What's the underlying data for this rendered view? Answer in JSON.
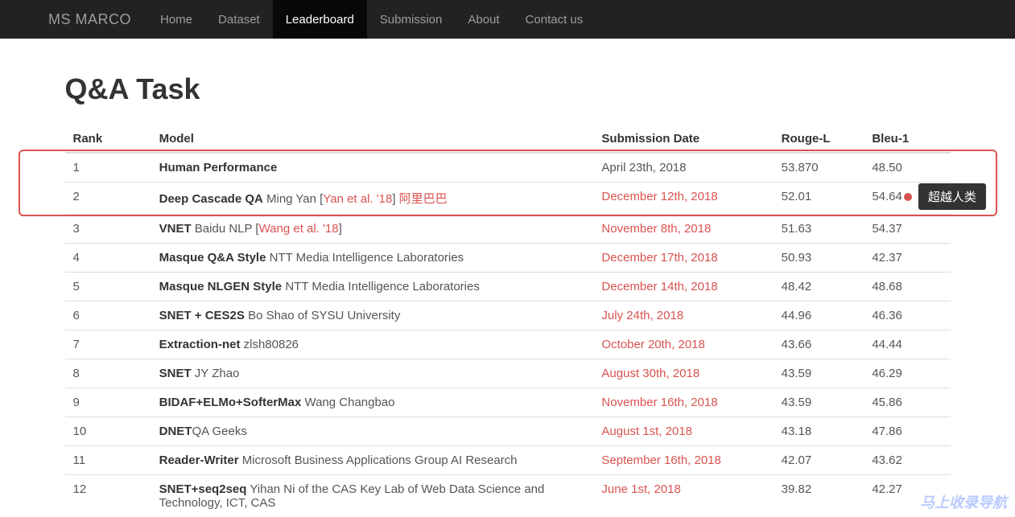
{
  "brand": "MS MARCO",
  "nav": {
    "items": [
      {
        "label": "Home",
        "active": false
      },
      {
        "label": "Dataset",
        "active": false
      },
      {
        "label": "Leaderboard",
        "active": true
      },
      {
        "label": "Submission",
        "active": false
      },
      {
        "label": "About",
        "active": false
      },
      {
        "label": "Contact us",
        "active": false
      }
    ]
  },
  "title": "Q&A Task",
  "columns": {
    "rank": "Rank",
    "model": "Model",
    "date": "Submission Date",
    "rouge": "Rouge-L",
    "bleu": "Bleu-1"
  },
  "rows": [
    {
      "rank": "1",
      "model": "Human Performance",
      "aff": "",
      "ref": null,
      "aff2": null,
      "date": "April 23th, 2018",
      "date_link": false,
      "rouge": "53.870",
      "bleu": "48.50"
    },
    {
      "rank": "2",
      "model": "Deep Cascade QA",
      "aff": " Ming Yan [",
      "ref": "Yan et al. '18",
      "ref_close": "]   ",
      "aff2": "阿里巴巴",
      "date": "December 12th, 2018",
      "date_link": true,
      "rouge": "52.01",
      "bleu": "54.64",
      "dot": true
    },
    {
      "rank": "3",
      "model": "VNET",
      "aff": " Baidu NLP [",
      "ref": "Wang et al. '18",
      "ref_close": "]",
      "aff2": null,
      "date": "November 8th, 2018",
      "date_link": true,
      "rouge": "51.63",
      "bleu": "54.37"
    },
    {
      "rank": "4",
      "model": "Masque Q&A Style",
      "aff": " NTT Media Intelligence Laboratories",
      "ref": null,
      "aff2": null,
      "date": "December 17th, 2018",
      "date_link": true,
      "rouge": "50.93",
      "bleu": "42.37"
    },
    {
      "rank": "5",
      "model": "Masque NLGEN Style",
      "aff": " NTT Media Intelligence Laboratories",
      "ref": null,
      "aff2": null,
      "date": "December 14th, 2018",
      "date_link": true,
      "rouge": "48.42",
      "bleu": "48.68"
    },
    {
      "rank": "6",
      "model": "SNET + CES2S",
      "aff": " Bo Shao of SYSU University",
      "ref": null,
      "aff2": null,
      "date": "July 24th, 2018",
      "date_link": true,
      "rouge": "44.96",
      "bleu": "46.36"
    },
    {
      "rank": "7",
      "model": "Extraction-net",
      "aff": " zlsh80826",
      "ref": null,
      "aff2": null,
      "date": "October 20th, 2018",
      "date_link": true,
      "rouge": "43.66",
      "bleu": "44.44"
    },
    {
      "rank": "8",
      "model": "SNET",
      "aff": " JY Zhao",
      "ref": null,
      "aff2": null,
      "date": "August 30th, 2018",
      "date_link": true,
      "rouge": "43.59",
      "bleu": "46.29"
    },
    {
      "rank": "9",
      "model": "BIDAF+ELMo+SofterMax",
      "aff": " Wang Changbao",
      "ref": null,
      "aff2": null,
      "date": "November 16th, 2018",
      "date_link": true,
      "rouge": "43.59",
      "bleu": "45.86"
    },
    {
      "rank": "10",
      "model": "DNET",
      "aff": "QA Geeks",
      "ref": null,
      "aff2": null,
      "date": "August 1st, 2018",
      "date_link": true,
      "rouge": "43.18",
      "bleu": "47.86"
    },
    {
      "rank": "11",
      "model": "Reader-Writer",
      "aff": " Microsoft Business Applications Group AI Research",
      "ref": null,
      "aff2": null,
      "date": "September 16th, 2018",
      "date_link": true,
      "rouge": "42.07",
      "bleu": "43.62"
    },
    {
      "rank": "12",
      "model": "SNET+seq2seq",
      "aff": " Yihan Ni of the CAS Key Lab of Web Data Science and Technology, ICT, CAS",
      "ref": null,
      "aff2": null,
      "date": "June 1st, 2018",
      "date_link": true,
      "rouge": "39.82",
      "bleu": "42.27"
    }
  ],
  "badge": "超越人类",
  "watermark": "马上收录导航"
}
